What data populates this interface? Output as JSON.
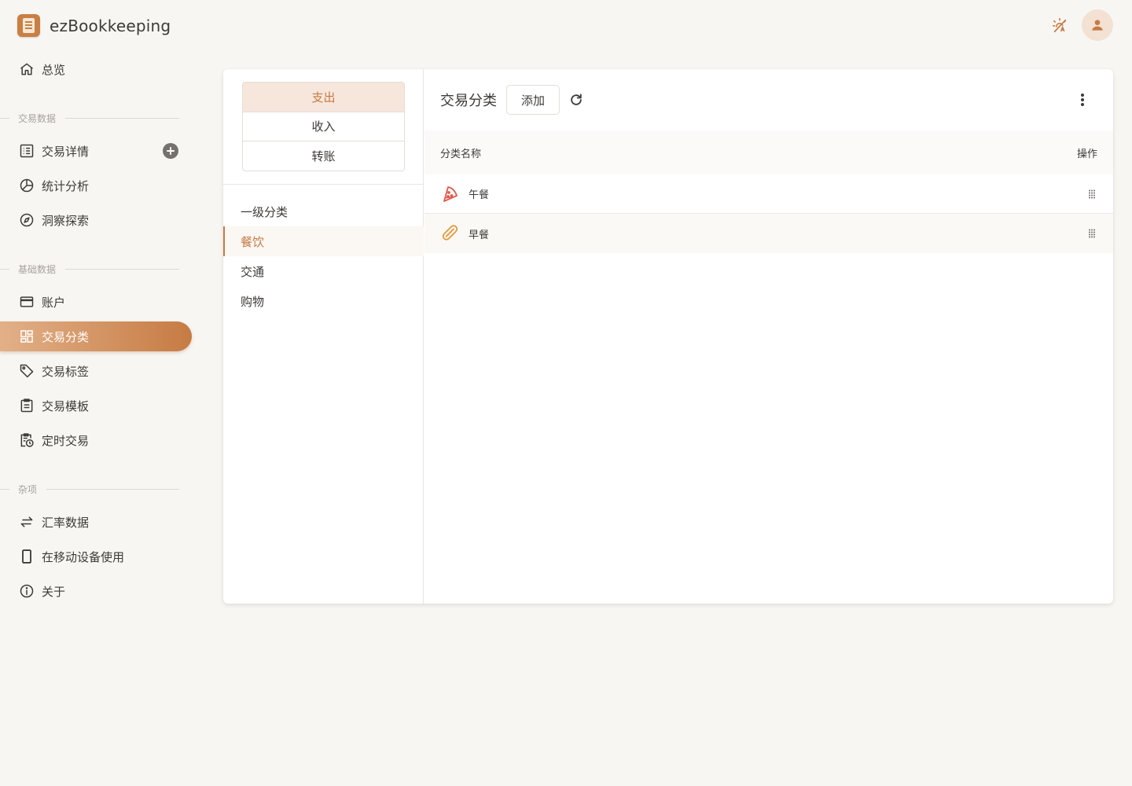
{
  "app": {
    "title": "ezBookkeeping"
  },
  "header": {
    "theme_icon": "theme-auto-icon",
    "avatar_icon": "user-icon"
  },
  "sidebar": {
    "overview": "总览",
    "sections": {
      "transaction_data": "交易数据",
      "basic_data": "基础数据",
      "misc": "杂项"
    },
    "items": {
      "transaction_details": "交易详情",
      "statistics": "统计分析",
      "insights": "洞察探索",
      "accounts": "账户",
      "categories": "交易分类",
      "tags": "交易标签",
      "templates": "交易模板",
      "scheduled": "定时交易",
      "exchange_rates": "汇率数据",
      "mobile": "在移动设备使用",
      "about": "关于"
    },
    "active": "categories"
  },
  "category_types": [
    "支出",
    "收入",
    "转账"
  ],
  "selected_type": "支出",
  "primary_list": {
    "title": "一级分类",
    "items": [
      "餐饮",
      "交通",
      "购物"
    ],
    "selected": "餐饮"
  },
  "content": {
    "title": "交易分类",
    "add_label": "添加",
    "columns": {
      "name": "分类名称",
      "actions": "操作"
    },
    "rows": [
      {
        "name": "午餐",
        "icon": "pizza-icon"
      },
      {
        "name": "早餐",
        "icon": "hotdog-icon"
      }
    ]
  },
  "colors": {
    "accent": "#c67b43",
    "pizza": "#e05a4e",
    "hotdog": "#e09a3e"
  }
}
